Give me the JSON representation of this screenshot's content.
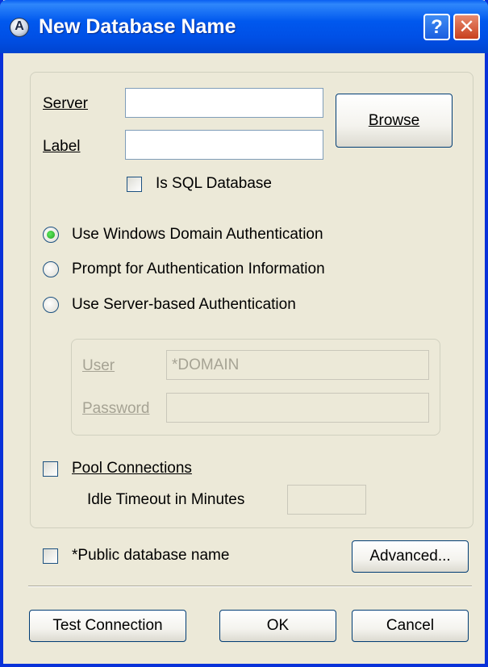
{
  "window": {
    "title": "New Database Name",
    "icon_letter": "A",
    "help_glyph": "?",
    "close_glyph": "✕"
  },
  "form": {
    "server_label": "Server",
    "server_value": "",
    "label_label": "Label",
    "label_value": "",
    "browse_label": "Browse",
    "is_sql_label": "Is SQL Database",
    "is_sql_checked": false
  },
  "auth": {
    "options": [
      {
        "label": "Use Windows Domain Authentication",
        "selected": true
      },
      {
        "label": "Prompt for Authentication Information",
        "selected": false
      },
      {
        "label": "Use Server-based Authentication",
        "selected": false
      }
    ],
    "user_label": "User",
    "user_value": "*DOMAIN",
    "password_label": "Password",
    "password_value": ""
  },
  "pool": {
    "label": "Pool Connections",
    "checked": false,
    "idle_label": "Idle Timeout in Minutes",
    "idle_value": ""
  },
  "public": {
    "label": "*Public database name",
    "checked": false
  },
  "buttons": {
    "advanced": "Advanced...",
    "test_connection": "Test Connection",
    "ok": "OK",
    "cancel": "Cancel"
  }
}
